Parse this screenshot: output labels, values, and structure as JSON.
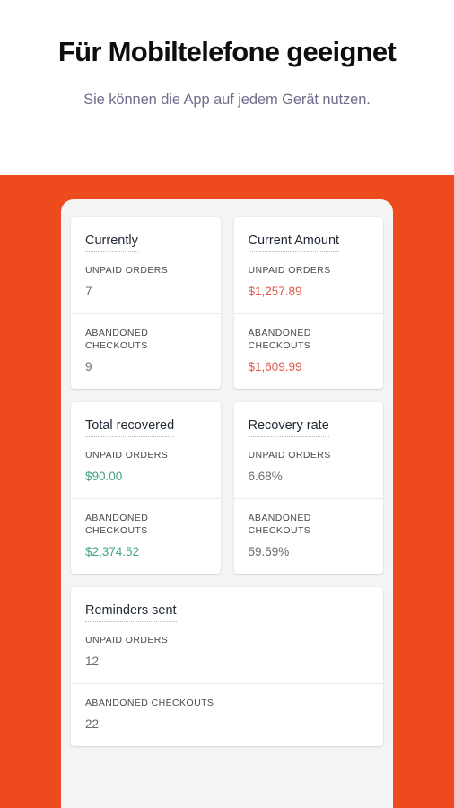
{
  "hero": {
    "title": "Für Mobiltelefone geeignet",
    "subtitle": "Sie können die App auf jedem Gerät nutzen."
  },
  "labels": {
    "unpaid_orders": "UNPAID ORDERS",
    "abandoned_checkouts": "ABANDONED CHECKOUTS"
  },
  "colors": {
    "stage_orange": "#ed4a1e",
    "phone_background": "#f4f4f4",
    "card_background": "#ffffff",
    "value_red": "#e0594b",
    "value_green": "#41a287",
    "value_neutral": "#6b6b6b",
    "subtitle_purple": "#6f6e8b"
  },
  "cards": [
    {
      "title": "Currently",
      "unpaid_orders": "7",
      "abandoned_checkouts": "9",
      "tone": "neutral",
      "full_width": false
    },
    {
      "title": "Current Amount",
      "unpaid_orders": "$1,257.89",
      "abandoned_checkouts": "$1,609.99",
      "tone": "red",
      "full_width": false
    },
    {
      "title": "Total recovered",
      "unpaid_orders": "$90.00",
      "abandoned_checkouts": "$2,374.52",
      "tone": "green",
      "full_width": false
    },
    {
      "title": "Recovery rate",
      "unpaid_orders": "6.68%",
      "abandoned_checkouts": "59.59%",
      "tone": "neutral",
      "full_width": false
    },
    {
      "title": "Reminders sent",
      "unpaid_orders": "12",
      "abandoned_checkouts": "22",
      "tone": "neutral",
      "full_width": true
    }
  ]
}
